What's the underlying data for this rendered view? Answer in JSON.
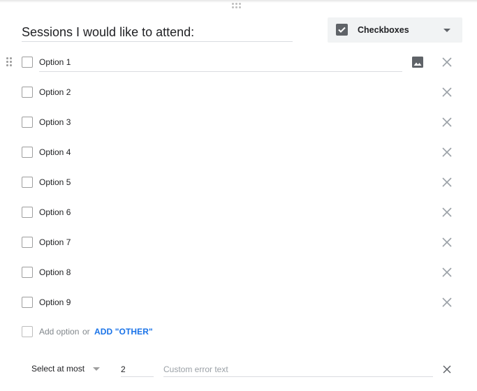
{
  "question": {
    "title": "Sessions I would like to attend:"
  },
  "question_type": {
    "selected": "Checkboxes",
    "icon": "checkbox-checked-icon"
  },
  "options": [
    {
      "label": "Option 1"
    },
    {
      "label": "Option 2"
    },
    {
      "label": "Option 3"
    },
    {
      "label": "Option 4"
    },
    {
      "label": "Option 5"
    },
    {
      "label": "Option 6"
    },
    {
      "label": "Option 7"
    },
    {
      "label": "Option 8"
    },
    {
      "label": "Option 9"
    }
  ],
  "add_row": {
    "add_option": "Add option",
    "or": "or",
    "add_other": "ADD \"OTHER\""
  },
  "validation": {
    "rule": "Select at most",
    "value": "2",
    "error_placeholder": "Custom error text"
  },
  "colors": {
    "accent": "#1a73e8",
    "icon": "#5f6368",
    "divider": "#dadce0"
  }
}
